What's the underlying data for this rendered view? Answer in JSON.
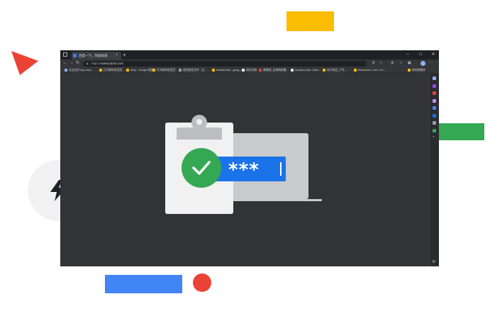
{
  "colors": {
    "yellow": "#fbbc04",
    "green": "#34a853",
    "blue": "#4285f4",
    "red": "#ea4335",
    "browser_bg": "#323337",
    "password_field": "#1a73e8"
  },
  "browser": {
    "tab": {
      "title": "百度一下，你就知道",
      "close_icon": "close-icon"
    },
    "new_tab_label": "+",
    "window_controls": {
      "minimize": "–",
      "maximize": "□",
      "close": "✕"
    },
    "toolbar": {
      "back": "←",
      "forward": "→",
      "reload": "↻",
      "url_protocol": "https://",
      "url_host": "www.baidu.com",
      "icons": [
        "read-aloud-icon",
        "favorite-star-icon",
        "extensions-icon",
        "favorites-icon",
        "collections-icon",
        "profile-icon",
        "more-icon"
      ]
    },
    "bookmarks": [
      {
        "label": "无法访问 http://ww...",
        "color": "#8ab4f8"
      },
      {
        "label": "打开新的标签页",
        "color": "#fbbc04"
      },
      {
        "label": "ebay - Google 搜索",
        "color": "#fbbc04"
      },
      {
        "label": "打开新的标签页",
        "color": "#fbbc04"
      },
      {
        "label": "使用指定文件 - 谷...",
        "color": "#9aa0a6"
      },
      {
        "label": "InstallGuide - goog...",
        "color": "#fbbc04"
      },
      {
        "label": "网址导航",
        "color": "#e8eaed"
      },
      {
        "label": "黄璐网_全球网购最...",
        "color": "#ea4335"
      },
      {
        "label": "Amazon.com: Onlin...",
        "color": "#e8eaed"
      },
      {
        "label": "电子商品_汽车...",
        "color": "#fbbc04"
      },
      {
        "label": "Electronics, Cars, Fa...",
        "color": "#fbbc04"
      },
      {
        "label": "其他收藏夹",
        "color": "#fbbc04"
      }
    ],
    "sidebar_icons": [
      {
        "name": "search-icon",
        "color": "#8ab4f8"
      },
      {
        "name": "tag-icon",
        "color": "#a142f4"
      },
      {
        "name": "briefcase-icon",
        "color": "#ea4335"
      },
      {
        "name": "games-icon",
        "color": "#c58af9"
      },
      {
        "name": "copilot-icon",
        "color": "#4285f4"
      },
      {
        "name": "outlook-icon",
        "color": "#1a73e8"
      },
      {
        "name": "send-icon",
        "color": "#9aa0a6"
      },
      {
        "name": "pin-icon",
        "color": "#34a853"
      },
      {
        "name": "add-icon",
        "color": "#9aa0a6"
      }
    ],
    "sidebar_settings_glyph": "⚙"
  },
  "illustration": {
    "password_mask": "***",
    "check_icon": "check-icon",
    "laptop_icon": "laptop-icon",
    "clipboard_icon": "clipboard-icon"
  },
  "bolt": {
    "icon": "lightning-bolt-icon"
  }
}
